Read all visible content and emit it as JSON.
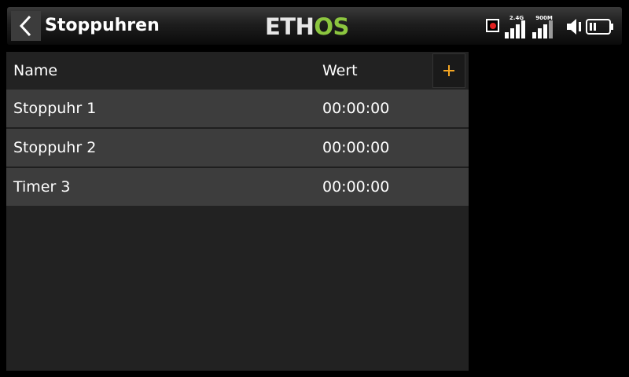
{
  "header": {
    "title": "Stoppuhren",
    "back_icon": "chevron-left-icon",
    "logo": {
      "part1": "ETH",
      "part2": "OS"
    }
  },
  "status": {
    "record_icon": "record-icon",
    "signal_24": {
      "label": "2.4G",
      "icon": "signal-bars-icon"
    },
    "signal_900": {
      "label": "900M",
      "icon": "signal-bars-icon"
    },
    "speaker_icon": "speaker-icon",
    "battery_icon": "battery-icon"
  },
  "table": {
    "columns": {
      "name": "Name",
      "value": "Wert"
    },
    "add_icon": "plus-icon",
    "rows": [
      {
        "name": "Stoppuhr 1",
        "value": "00:00:00"
      },
      {
        "name": "Stoppuhr 2",
        "value": "00:00:00"
      },
      {
        "name": "Timer 3",
        "value": "00:00:00"
      }
    ]
  },
  "colors": {
    "accent": "#f5a623",
    "logo_green": "#8cc63f",
    "record": "#e02020",
    "row_bg": "#3d3d3d",
    "panel_bg": "#222222"
  }
}
